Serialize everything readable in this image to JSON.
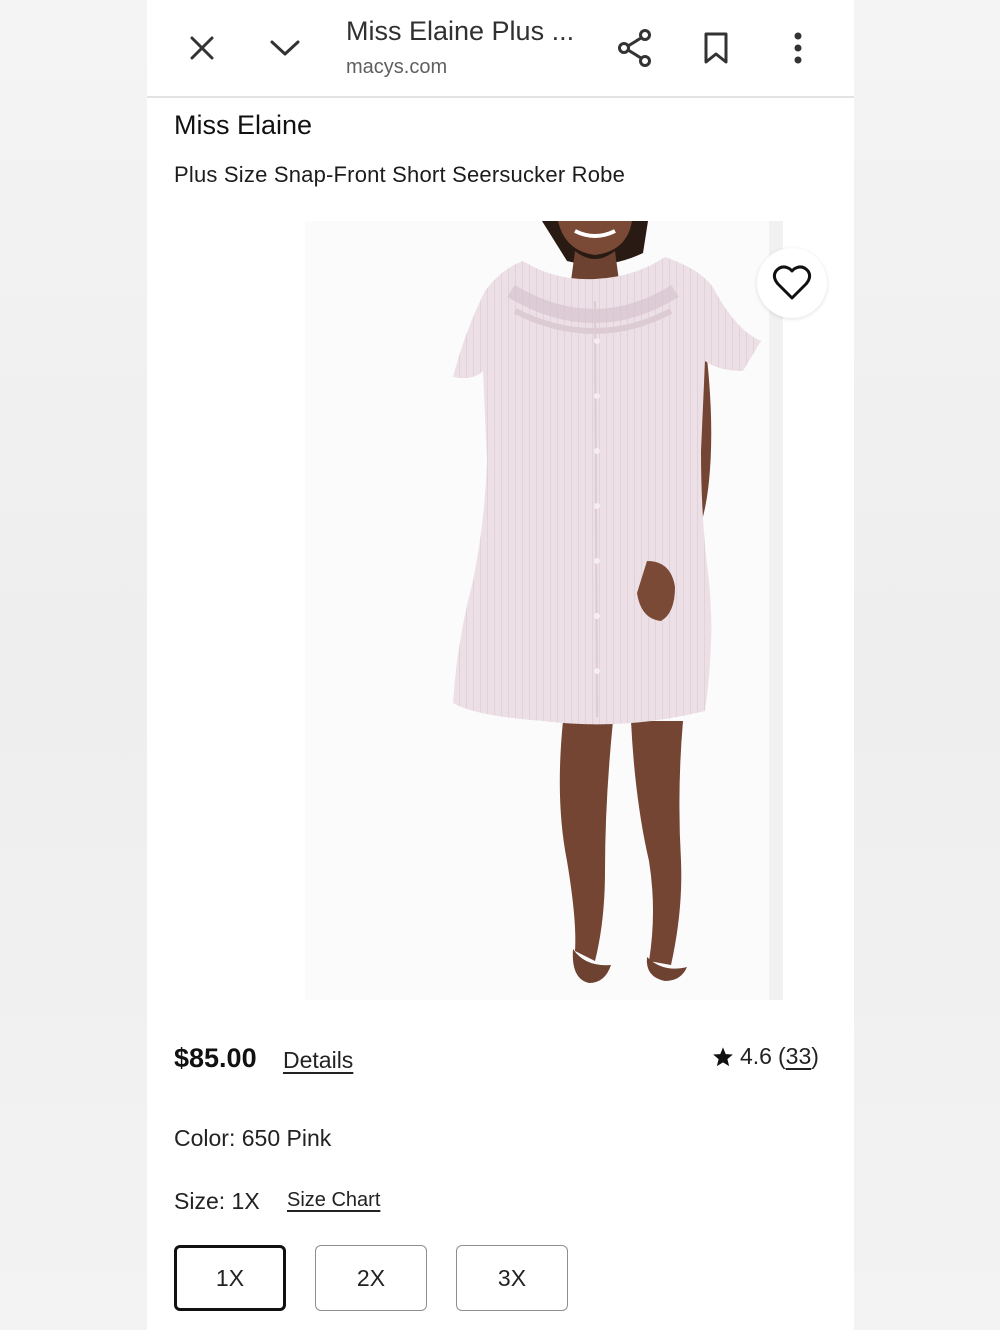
{
  "browser": {
    "title": "Miss Elaine Plus ...",
    "url": "macys.com",
    "icons": [
      "close-icon",
      "chevron-down-icon",
      "share-icon",
      "bookmark-icon",
      "more-vert-icon"
    ]
  },
  "product": {
    "brand": "Miss Elaine",
    "name": "Plus Size Snap-Front Short Seersucker Robe",
    "image": "pink seersucker robe on model",
    "price": "$85.00",
    "details_label": "Details",
    "rating": "4.6",
    "review_count": "33",
    "review_open": "(",
    "review_close": ")",
    "color_label": "Color: 650 Pink",
    "size_label": "Size: 1X",
    "size_chart_label": "Size Chart",
    "sizes": [
      "1X",
      "2X",
      "3X"
    ],
    "selected_size": "1X"
  },
  "colors": {
    "robe": "#e9dbe2",
    "skin": "#7a4a36",
    "background": "#ffffff"
  }
}
